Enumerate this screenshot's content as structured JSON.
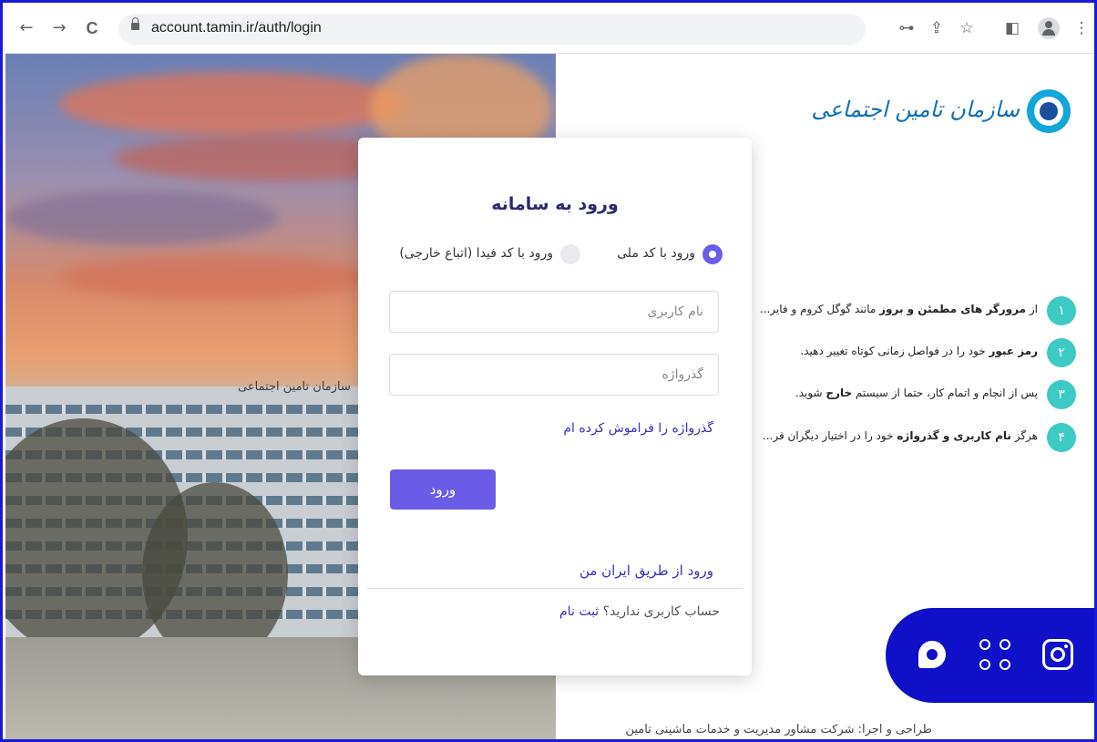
{
  "browser": {
    "url": "account.tamin.ir/auth/login",
    "back_icon": "←",
    "forward_icon": "→",
    "reload_icon": "C",
    "key_icon": "⊶",
    "share_icon": "⇪",
    "star_icon": "☆",
    "panel_icon": "◧",
    "menu_icon": "⋮"
  },
  "photo": {
    "building_sign": "سازمان تامین اجتماعی"
  },
  "logo": {
    "text": "سازمان تامین اجتماعی"
  },
  "login": {
    "title": "ورود به سامانه",
    "radio_national": "ورود با کد ملی",
    "radio_fida": "ورود با کد فیدا (اتباع خارجی)",
    "username_placeholder": "نام کاربری",
    "password_placeholder": "گذرواژه",
    "forgot_link": "گذرواژه را فراموش کرده ام",
    "submit_label": "ورود",
    "iranman_link": "ورود از طریق ایران من",
    "no_account": "حساب کاربری ندارید؟",
    "register_link": "ثبت نام"
  },
  "tips": [
    {
      "num": "۱",
      "pre": "از ",
      "bold": "مرورگر های مطمئن و بروز",
      "post": " مانند گوگل کروم و فایر..."
    },
    {
      "num": "۲",
      "pre": "",
      "bold": "رمز عبور",
      "post": " خود را در فواصل زمانی کوتاه تغییر دهید."
    },
    {
      "num": "۳",
      "pre": "پس از انجام و اتمام کار، حتما از سیستم ",
      "bold": "خارج",
      "post": " شوید."
    },
    {
      "num": "۴",
      "pre": "هرگز ",
      "bold": "نام کاربری و گذرواژه",
      "post": " خود را در اختیار دیگران قر..."
    }
  ],
  "footer": {
    "text": "طراحی و اجرا: شرکت مشاور مدیریت و خدمات ماشینی تامین"
  },
  "colors": {
    "accent": "#6b5ce7",
    "tip_badge": "#3dc9c4",
    "social_bar": "#1010c8",
    "link": "#3a2fb5",
    "frame": "#1a1ad6"
  }
}
